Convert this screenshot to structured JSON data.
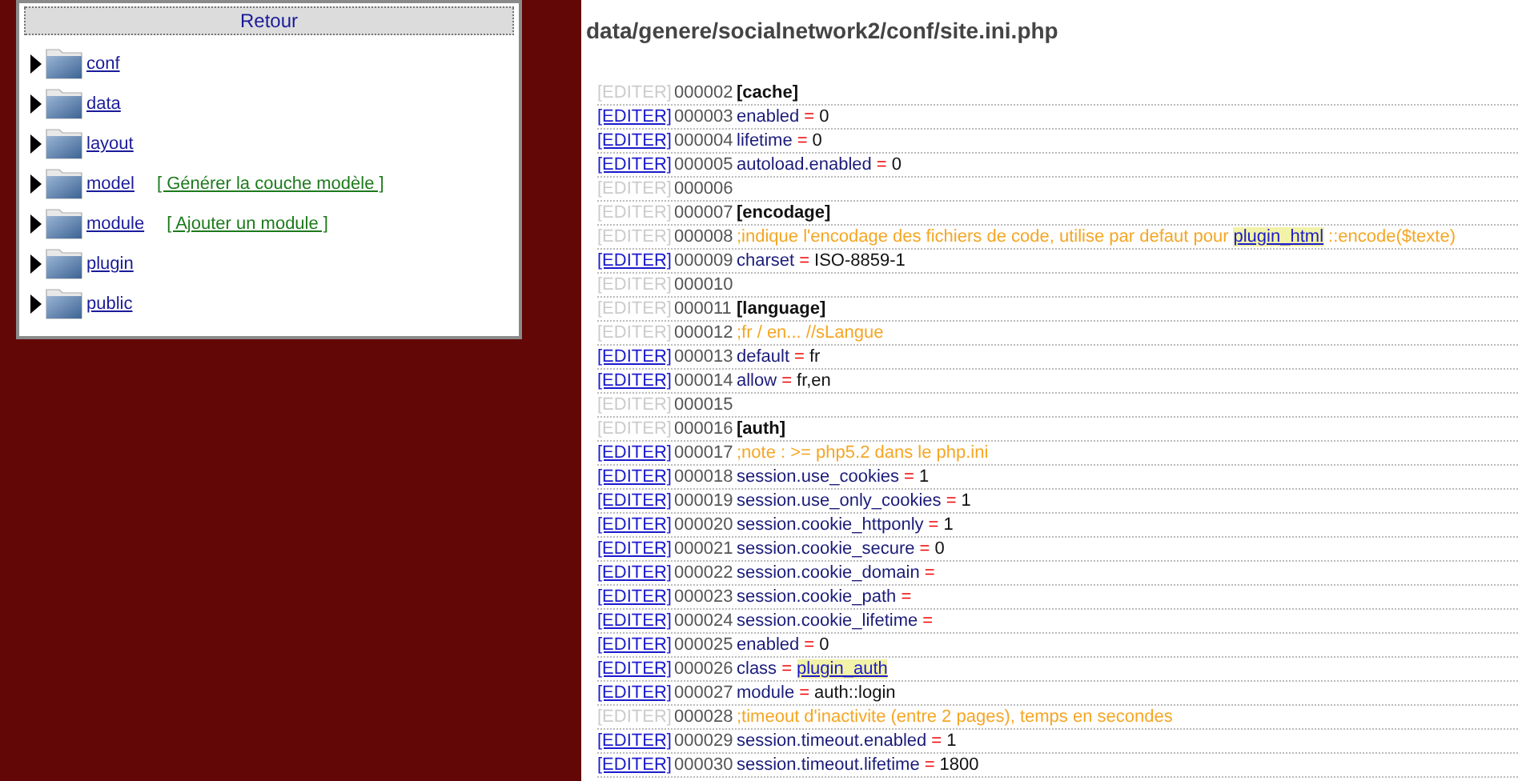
{
  "sidebar": {
    "back": "Retour",
    "items": [
      {
        "label": "conf"
      },
      {
        "label": "data"
      },
      {
        "label": "layout"
      },
      {
        "label": "model",
        "action": "[ Générer la couche modèle ]"
      },
      {
        "label": "module",
        "action": "[ Ajouter un module ]"
      },
      {
        "label": "plugin"
      },
      {
        "label": "public"
      }
    ]
  },
  "file": {
    "title": "data/genere/socialnetwork2/conf/site.ini.php",
    "lines": [
      {
        "edit": "[EDITER]",
        "editable": false,
        "number": "000002",
        "kind": "section",
        "text": "[cache]"
      },
      {
        "edit": "[EDITER]",
        "editable": true,
        "number": "000003",
        "kind": "setting",
        "key": "enabled",
        "sign": "=",
        "value": [
          {
            "kind": "text",
            "text": "0"
          }
        ]
      },
      {
        "edit": "[EDITER]",
        "editable": true,
        "number": "000004",
        "kind": "setting",
        "key": "lifetime",
        "sign": "=",
        "value": [
          {
            "kind": "text",
            "text": "0"
          }
        ]
      },
      {
        "edit": "[EDITER]",
        "editable": true,
        "number": "000005",
        "kind": "setting",
        "key": "autoload.enabled",
        "sign": "=",
        "value": [
          {
            "kind": "text",
            "text": "0"
          }
        ]
      },
      {
        "edit": "[EDITER]",
        "editable": false,
        "number": "000006",
        "kind": "empty"
      },
      {
        "edit": "[EDITER]",
        "editable": false,
        "number": "000007",
        "kind": "section",
        "text": "[encodage]"
      },
      {
        "edit": "[EDITER]",
        "editable": false,
        "number": "000008",
        "kind": "comment",
        "parts": [
          {
            "kind": "text",
            "text": ";indique l'encodage des fichiers de code, utilise par defaut pour"
          },
          {
            "kind": "link",
            "text": "plugin_html"
          },
          {
            "kind": "text",
            "text": "::encode($texte)"
          }
        ]
      },
      {
        "edit": "[EDITER]",
        "editable": true,
        "number": "000009",
        "kind": "setting",
        "key": "charset",
        "sign": "=",
        "value": [
          {
            "kind": "text",
            "text": "ISO-8859-1"
          }
        ]
      },
      {
        "edit": "[EDITER]",
        "editable": false,
        "number": "000010",
        "kind": "empty"
      },
      {
        "edit": "[EDITER]",
        "editable": false,
        "number": "000011",
        "kind": "section",
        "text": "[language]"
      },
      {
        "edit": "[EDITER]",
        "editable": false,
        "number": "000012",
        "kind": "comment",
        "parts": [
          {
            "kind": "text",
            "text": ";fr / en... //sLangue"
          }
        ]
      },
      {
        "edit": "[EDITER]",
        "editable": true,
        "number": "000013",
        "kind": "setting",
        "key": "default",
        "sign": "=",
        "value": [
          {
            "kind": "text",
            "text": "fr"
          }
        ]
      },
      {
        "edit": "[EDITER]",
        "editable": true,
        "number": "000014",
        "kind": "setting",
        "key": "allow",
        "sign": "=",
        "value": [
          {
            "kind": "text",
            "text": "fr,en"
          }
        ]
      },
      {
        "edit": "[EDITER]",
        "editable": false,
        "number": "000015",
        "kind": "empty"
      },
      {
        "edit": "[EDITER]",
        "editable": false,
        "number": "000016",
        "kind": "section",
        "text": "[auth]"
      },
      {
        "edit": "[EDITER]",
        "editable": true,
        "number": "000017",
        "kind": "comment",
        "parts": [
          {
            "kind": "text",
            "text": ";note : >= php5.2 dans le php.ini"
          }
        ]
      },
      {
        "edit": "[EDITER]",
        "editable": true,
        "number": "000018",
        "kind": "setting",
        "key": "session.use_cookies",
        "sign": "=",
        "value": [
          {
            "kind": "text",
            "text": "1"
          }
        ]
      },
      {
        "edit": "[EDITER]",
        "editable": true,
        "number": "000019",
        "kind": "setting",
        "key": "session.use_only_cookies",
        "sign": "=",
        "value": [
          {
            "kind": "text",
            "text": "1"
          }
        ]
      },
      {
        "edit": "[EDITER]",
        "editable": true,
        "number": "000020",
        "kind": "setting",
        "key": "session.cookie_httponly",
        "sign": "=",
        "value": [
          {
            "kind": "text",
            "text": "1"
          }
        ]
      },
      {
        "edit": "[EDITER]",
        "editable": true,
        "number": "000021",
        "kind": "setting",
        "key": "session.cookie_secure",
        "sign": "=",
        "value": [
          {
            "kind": "text",
            "text": "0"
          }
        ]
      },
      {
        "edit": "[EDITER]",
        "editable": true,
        "number": "000022",
        "kind": "setting",
        "key": "session.cookie_domain",
        "sign": "="
      },
      {
        "edit": "[EDITER]",
        "editable": true,
        "number": "000023",
        "kind": "setting",
        "key": "session.cookie_path",
        "sign": "="
      },
      {
        "edit": "[EDITER]",
        "editable": true,
        "number": "000024",
        "kind": "setting",
        "key": "session.cookie_lifetime",
        "sign": "="
      },
      {
        "edit": "[EDITER]",
        "editable": true,
        "number": "000025",
        "kind": "setting",
        "key": "enabled",
        "sign": "=",
        "value": [
          {
            "kind": "text",
            "text": "0"
          }
        ]
      },
      {
        "edit": "[EDITER]",
        "editable": true,
        "number": "000026",
        "kind": "setting",
        "key": "class",
        "sign": "=",
        "value": [
          {
            "kind": "link",
            "text": "plugin_auth"
          }
        ]
      },
      {
        "edit": "[EDITER]",
        "editable": true,
        "number": "000027",
        "kind": "setting",
        "key": "module",
        "sign": "=",
        "value": [
          {
            "kind": "text",
            "text": "auth::login"
          }
        ]
      },
      {
        "edit": "[EDITER]",
        "editable": false,
        "number": "000028",
        "kind": "comment",
        "parts": [
          {
            "kind": "text",
            "text": ";timeout d'inactivite (entre 2 pages), temps en secondes"
          }
        ]
      },
      {
        "edit": "[EDITER]",
        "editable": true,
        "number": "000029",
        "kind": "setting",
        "key": "session.timeout.enabled",
        "sign": "=",
        "value": [
          {
            "kind": "text",
            "text": "1"
          }
        ]
      },
      {
        "edit": "[EDITER]",
        "editable": true,
        "number": "000030",
        "kind": "setting",
        "key": "session.timeout.lifetime",
        "sign": "=",
        "value": [
          {
            "kind": "text",
            "text": "1800"
          }
        ]
      }
    ]
  }
}
